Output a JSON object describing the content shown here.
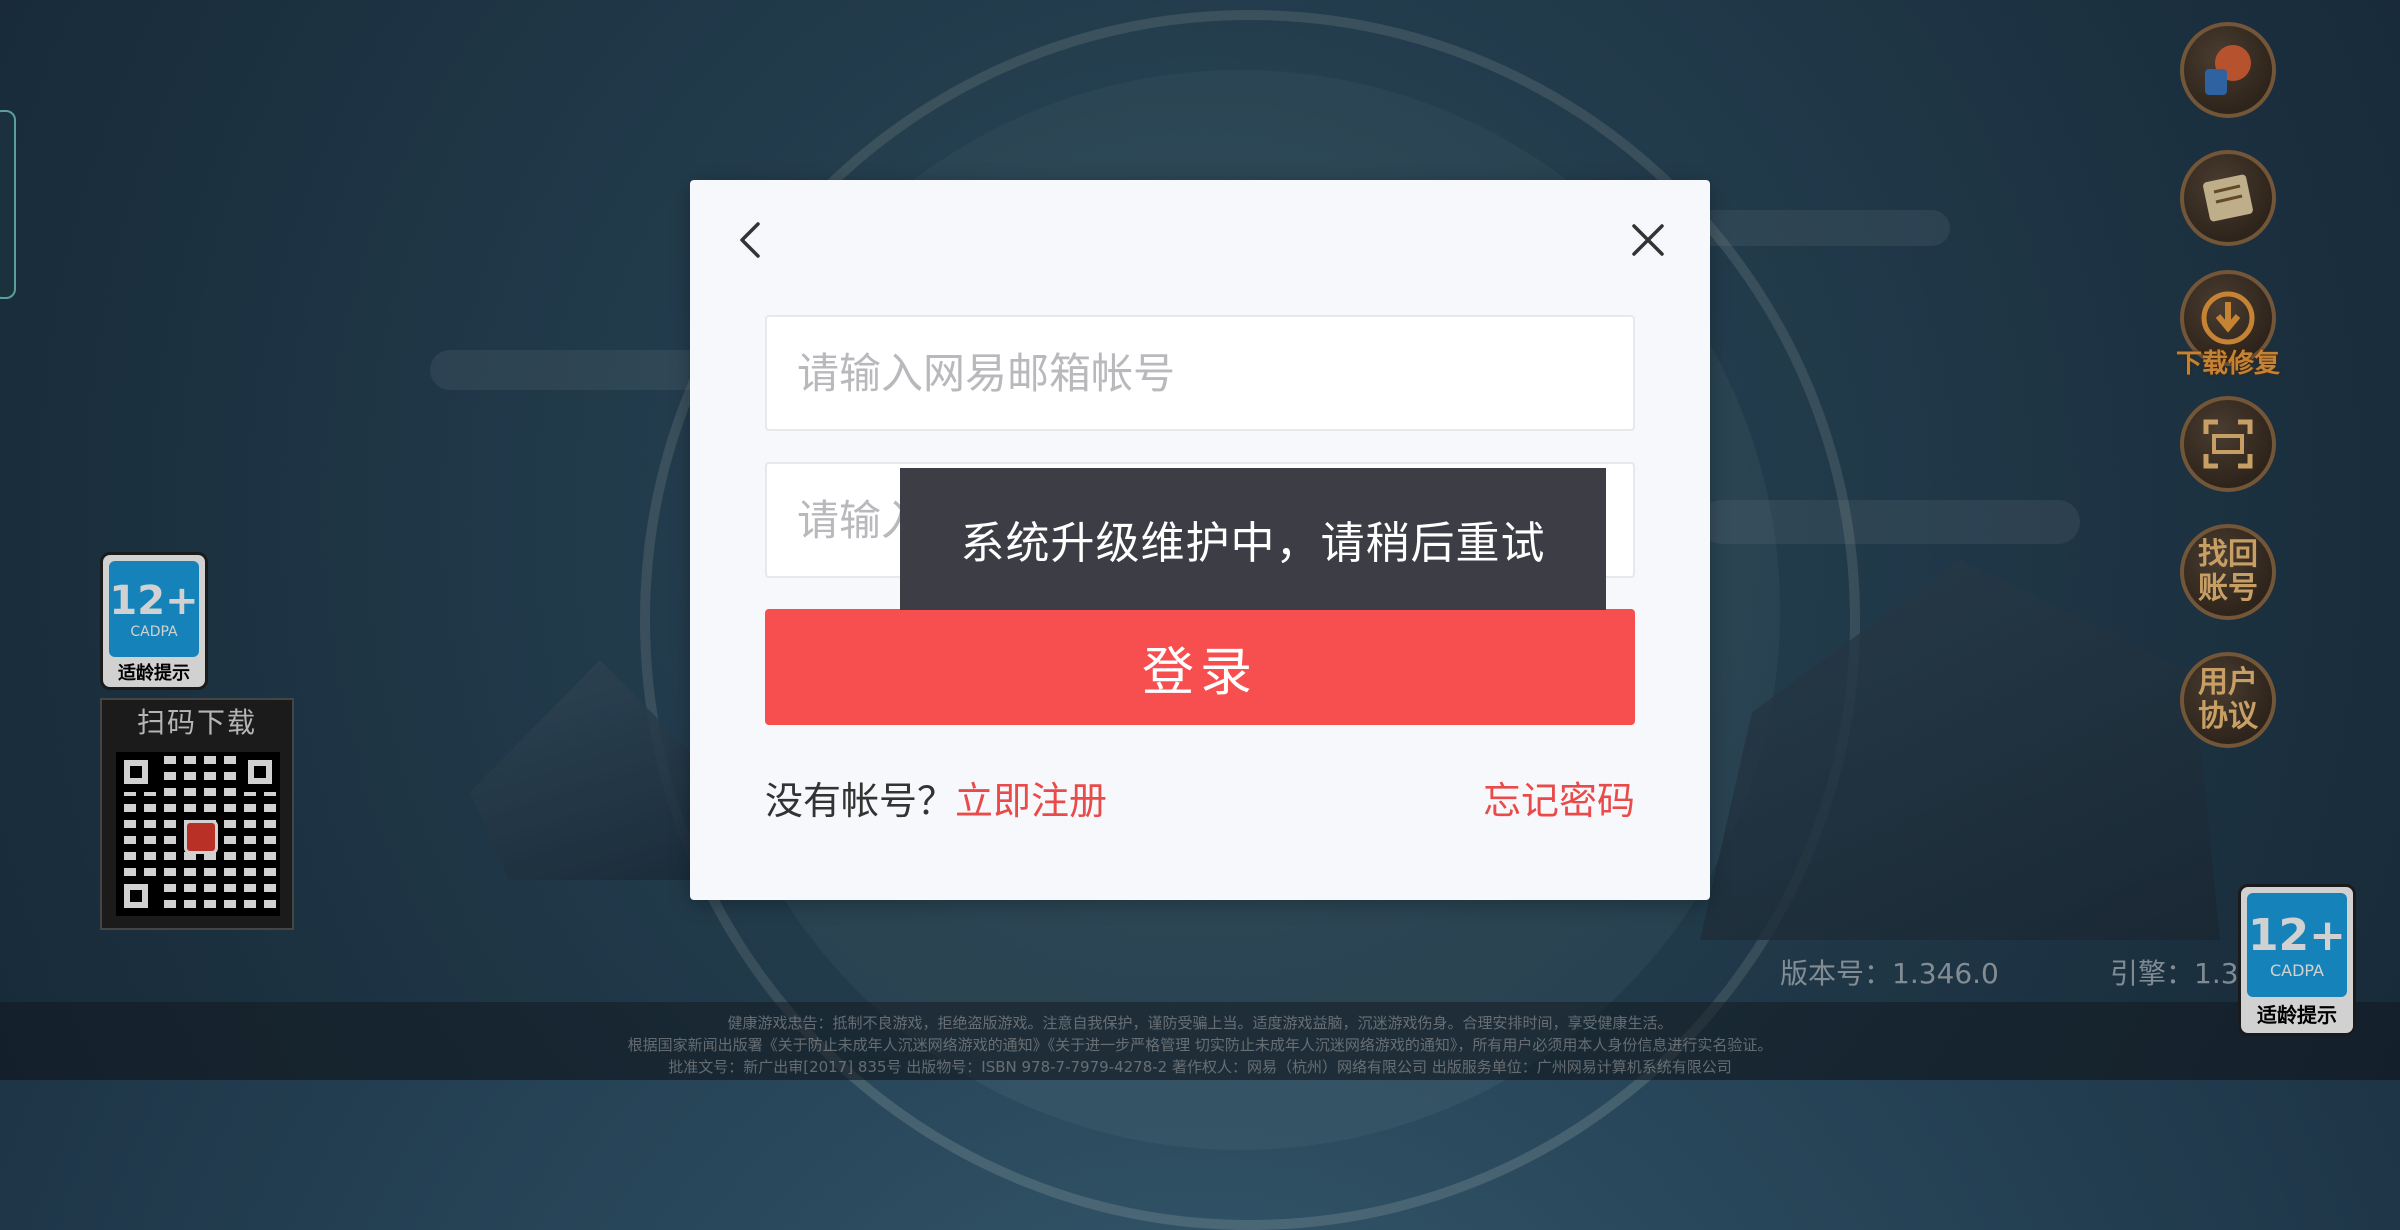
{
  "login_dialog": {
    "email_placeholder": "请输入网易邮箱帐号",
    "password_placeholder": "请输入密码",
    "login_label": "登录",
    "no_account_text": "没有帐号？",
    "register_label": "立即注册",
    "forgot_password_label": "忘记密码"
  },
  "toast": {
    "message": "系统升级维护中，请稍后重试"
  },
  "qr": {
    "title": "扫码下载"
  },
  "age_rating": {
    "rating": "12+",
    "org": "CADPA",
    "tag": "适龄提示"
  },
  "side_buttons": {
    "download_repair": "下载修复",
    "find_account": "找回\n账号",
    "user_agreement": "用户\n协议"
  },
  "footer": {
    "version": "版本号：1.346.0",
    "engine": "引擎：1.3",
    "line1": "健康游戏忠告：抵制不良游戏，拒绝盗版游戏。注意自我保护，谨防受骗上当。适度游戏益脑，沉迷游戏伤身。合理安排时间，享受健康生活。",
    "line2": "根据国家新闻出版署《关于防止未成年人沉迷网络游戏的通知》《关于进一步严格管理 切实防止未成年人沉迷网络游戏的通知》，所有用户必须用本人身份信息进行实名验证。",
    "line3": "批准文号：新广出审[2017] 835号 出版物号：ISBN 978-7-7979-4278-2 著作权人：网易（杭州）网络有限公司 出版服务单位：广州网易计算机系统有限公司"
  },
  "colors": {
    "accent": "#f74f4f",
    "link": "#e94b4b",
    "toast_bg": "#3d3e45"
  }
}
